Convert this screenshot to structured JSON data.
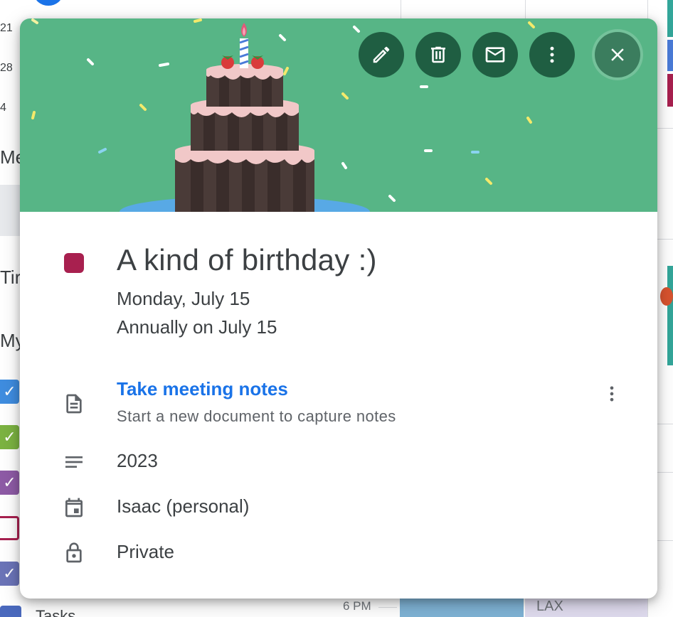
{
  "background": {
    "day_numbers": [
      "21",
      "28",
      "4"
    ],
    "label_partials": [
      "Me",
      "Tir",
      "My"
    ],
    "time_label": "6 PM",
    "event_label": "LAX",
    "tasks_label": "Tasks"
  },
  "event": {
    "title": "A kind of birthday :)",
    "date": "Monday, July 15",
    "recurrence": "Annually on July 15",
    "color": "#a8204f",
    "banner_color": "#57b586"
  },
  "toolbar": {
    "buttons": [
      {
        "name": "edit",
        "icon": "pencil-icon"
      },
      {
        "name": "delete",
        "icon": "trash-icon"
      },
      {
        "name": "email",
        "icon": "mail-icon"
      },
      {
        "name": "more",
        "icon": "more-vert-icon"
      },
      {
        "name": "close",
        "icon": "close-icon"
      }
    ]
  },
  "notes": {
    "link": "Take meeting notes",
    "subtitle": "Start a new document to capture notes",
    "icon": "document-icon"
  },
  "description": {
    "text": "2023",
    "icon": "description-lines-icon"
  },
  "calendar": {
    "name": "Isaac (personal)",
    "icon": "calendar-icon"
  },
  "visibility": {
    "text": "Private",
    "icon": "lock-icon"
  }
}
